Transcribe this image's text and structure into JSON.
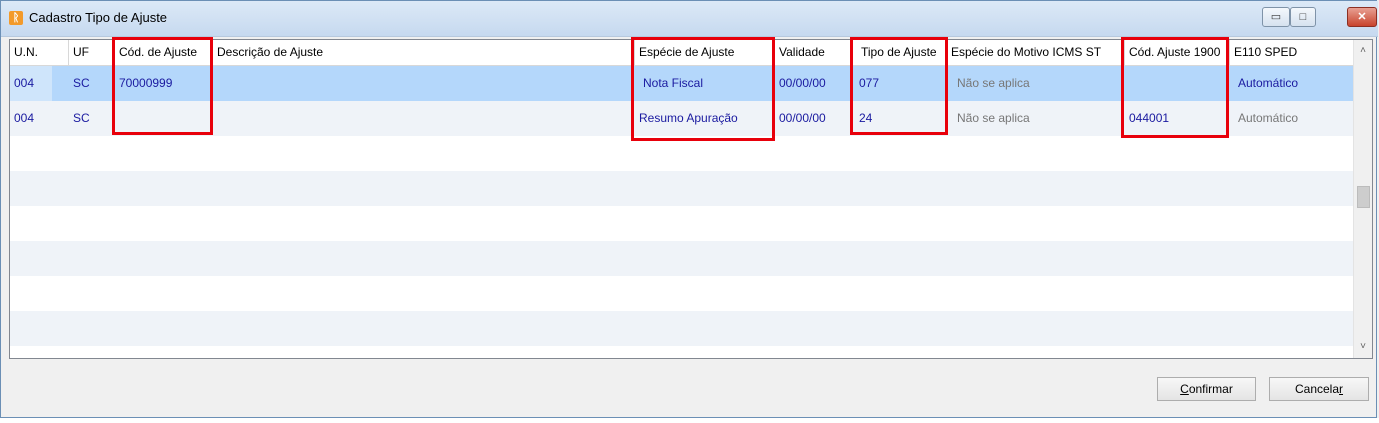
{
  "window": {
    "title": "Cadastro Tipo de Ajuste",
    "minimize_glyph": "▭",
    "maximize_glyph": "□",
    "close_glyph": "✕",
    "app_icon": "orange-app-icon",
    "app_icon_glyph": "ᚱ"
  },
  "grid": {
    "columns": [
      "U.N.",
      "UF",
      "Cód. de Ajuste",
      "Descrição de Ajuste",
      "Espécie de Ajuste",
      "Validade",
      "Tipo de Ajuste",
      "Espécie do Motivo ICMS ST",
      "Cód. Ajuste 1900",
      "E110 SPED"
    ],
    "rows": [
      {
        "un": "004",
        "uf": "SC",
        "cod_ajuste": "70000999",
        "descricao": "",
        "especie": "Nota Fiscal",
        "validade": "00/00/00",
        "tipo": "077",
        "especie_motivo": "Não se aplica",
        "cod_1900": "",
        "e110": "Automático"
      },
      {
        "un": "004",
        "uf": "SC",
        "cod_ajuste": "",
        "descricao": "",
        "especie": "Resumo Apuração",
        "validade": "00/00/00",
        "tipo": "24",
        "especie_motivo": "Não se aplica",
        "cod_1900": "044001",
        "e110": "Automático"
      }
    ],
    "scroll_up_glyph": "˄",
    "scroll_down_glyph": "˅"
  },
  "buttons": {
    "confirm_first": "C",
    "confirm_rest": "onfirmar",
    "cancel_main": "Cancela",
    "cancel_last": "r"
  },
  "colors": {
    "highlight_box": "#e8000b",
    "selected_row": "#b4d7fb",
    "cell_text": "#1a1aa0"
  }
}
